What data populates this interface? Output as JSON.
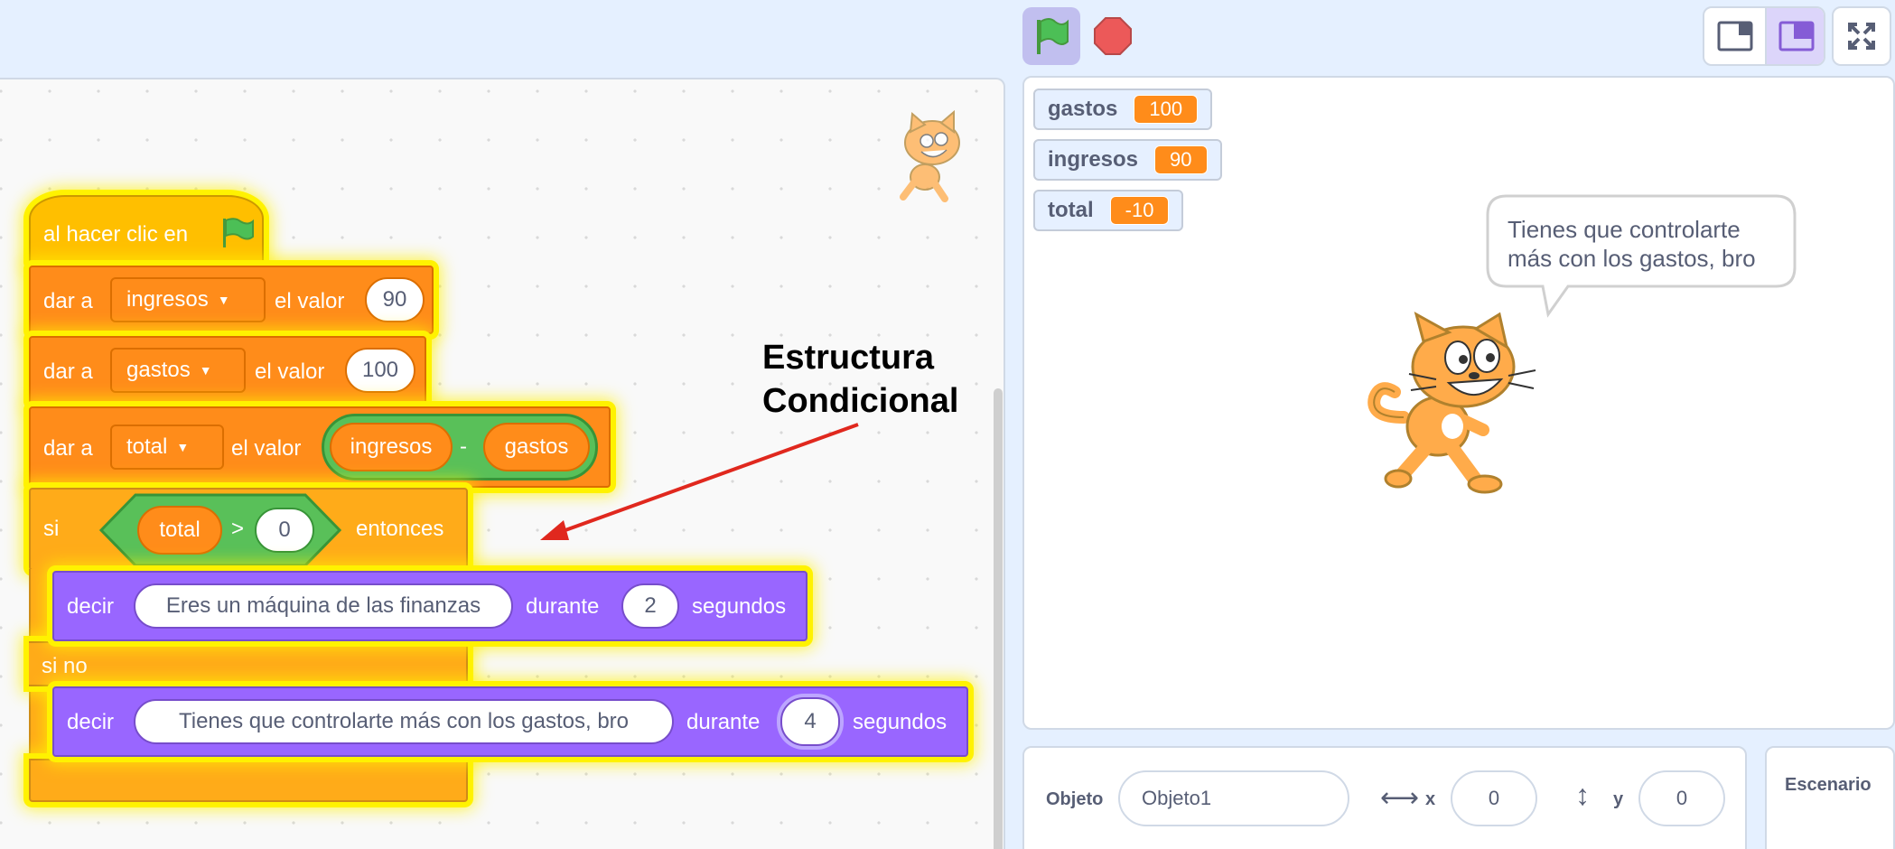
{
  "header": {
    "flag_icon": "green-flag-icon",
    "stop_icon": "stop-sign-icon",
    "layout_small_icon": "small-stage-icon",
    "layout_normal_icon": "normal-stage-icon",
    "fullscreen_icon": "fullscreen-icon"
  },
  "script": {
    "hat_label": "al hacer clic en",
    "set1": {
      "prefix": "dar a",
      "var": "ingresos",
      "mid": "el valor",
      "value": "90"
    },
    "set2": {
      "prefix": "dar a",
      "var": "gastos",
      "mid": "el valor",
      "value": "100"
    },
    "set3": {
      "prefix": "dar a",
      "var": "total",
      "mid": "el valor",
      "op_left": "ingresos",
      "op_symbol": "-",
      "op_right": "gastos"
    },
    "if_block": {
      "if_label": "si",
      "cond_left": "total",
      "cond_op": ">",
      "cond_right": "0",
      "then_label": "entonces",
      "else_label": "si no"
    },
    "say1": {
      "prefix": "decir",
      "text": "Eres un máquina de las finanzas",
      "mid": "durante",
      "secs": "2",
      "suffix": "segundos"
    },
    "say2": {
      "prefix": "decir",
      "text": "Tienes que controlarte más con los gastos, bro",
      "mid": "durante",
      "secs": "4",
      "suffix": "segundos"
    }
  },
  "annotation": {
    "line1": "Estructura",
    "line2": "Condicional",
    "color": "#e0281e"
  },
  "stage": {
    "monitors": [
      {
        "label": "gastos",
        "value": "100"
      },
      {
        "label": "ingresos",
        "value": "90"
      },
      {
        "label": "total",
        "value": "-10"
      }
    ],
    "speech_line1": "Tienes que controlarte",
    "speech_line2": "más con los gastos, bro"
  },
  "sprite_info": {
    "object_label": "Objeto",
    "object_name": "Objeto1",
    "x_label": "x",
    "x_value": "0",
    "y_label": "y",
    "y_value": "0",
    "stage_label": "Escenario"
  },
  "colors": {
    "events": "#ffbf00",
    "variables": "#ff8c1a",
    "control": "#ffab19",
    "looks": "#9966ff",
    "operators": "#59c059"
  }
}
